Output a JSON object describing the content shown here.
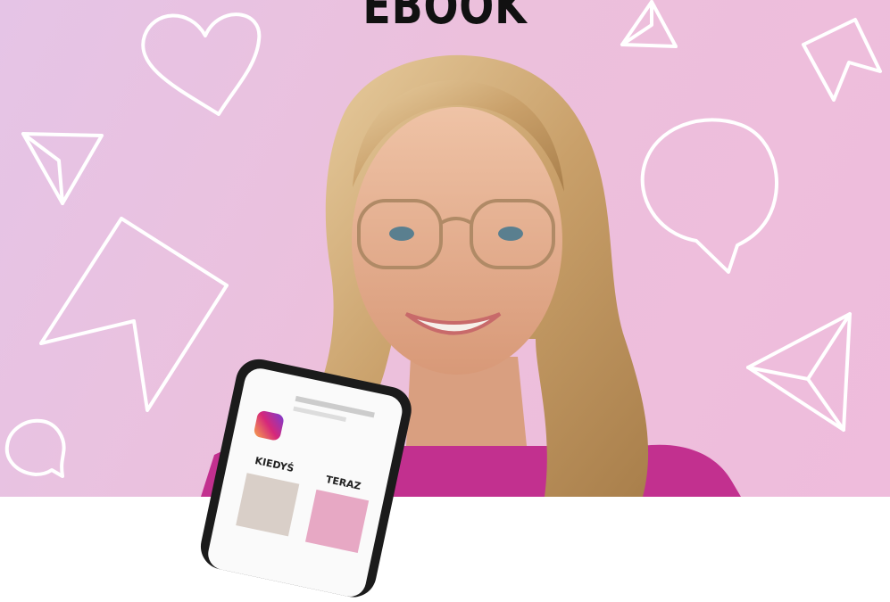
{
  "header": {
    "title": "EBOOK"
  },
  "background": {
    "gradient_start": "#e5c4e6",
    "gradient_end": "#efbcdc"
  },
  "phone": {
    "labels": {
      "left": "KIEDYŚ",
      "right": "TERAZ"
    },
    "brand_color": "#d6287a"
  },
  "icons": [
    "heart-outline-icon",
    "paper-plane-icon",
    "bookmark-arrow-icon",
    "speech-bubble-icon"
  ]
}
